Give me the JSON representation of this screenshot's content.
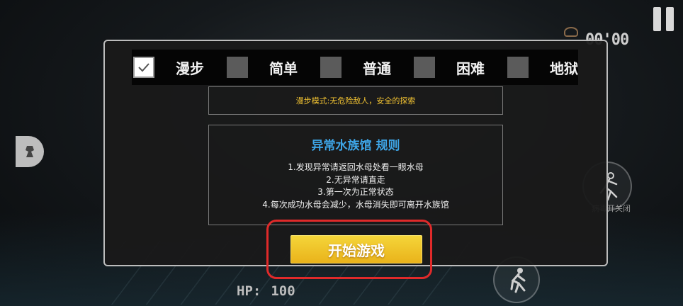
{
  "hud": {
    "timer": "00'00",
    "hp_label": "HP:",
    "hp_value": "100",
    "right_action_label": "病毒开关闭"
  },
  "difficulty": {
    "options": [
      {
        "label": "漫步",
        "checked": true
      },
      {
        "label": "简单",
        "checked": false
      },
      {
        "label": "普通",
        "checked": false
      },
      {
        "label": "困难",
        "checked": false
      },
      {
        "label": "地狱",
        "checked": false
      }
    ]
  },
  "mode_description": "漫步模式:无危险敌人，安全的探索",
  "rules": {
    "title": "异常水族馆 规则",
    "items": [
      "1.发现异常请返回水母处看一眼水母",
      "2.无异常请直走",
      "3.第一次为正常状态",
      "4.每次成功水母会减少，水母消失即可离开水族馆"
    ]
  },
  "start_button_label": "开始游戏",
  "colors": {
    "accent_yellow": "#f1c232",
    "rules_title_blue": "#3ea6e8",
    "button_yellow": "#efc228",
    "highlight_red": "#e02a2a"
  }
}
